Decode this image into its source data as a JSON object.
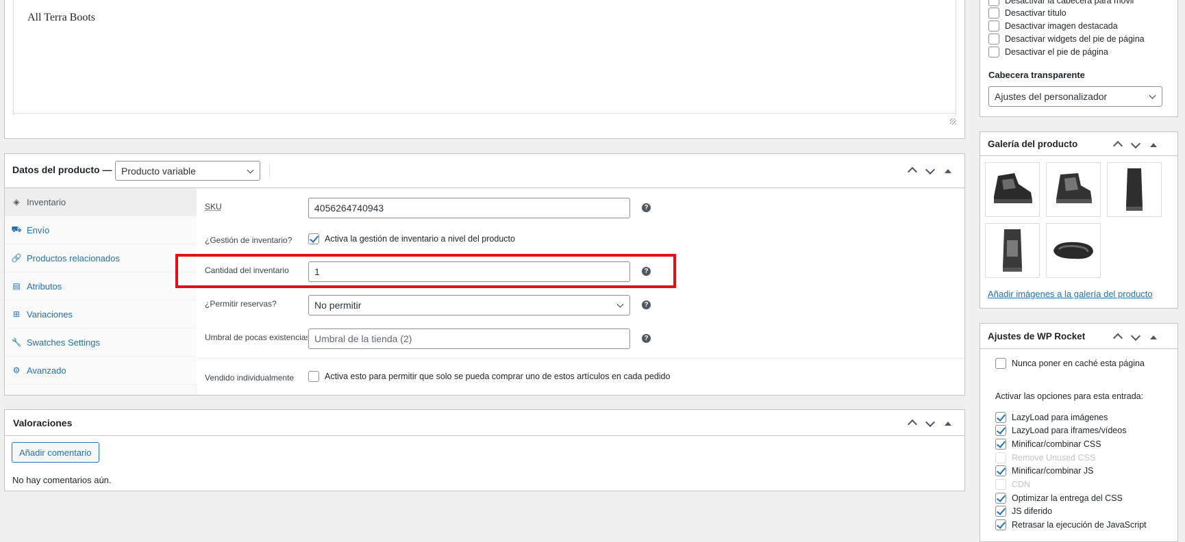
{
  "editor": {
    "content": "All Terra Boots"
  },
  "product_data": {
    "title": "Datos del producto —",
    "type_selected": "Producto variable",
    "tabs": [
      {
        "label": "Inventario",
        "icon": "tag-icon"
      },
      {
        "label": "Envío",
        "icon": "truck-icon"
      },
      {
        "label": "Productos relacionados",
        "icon": "link-icon"
      },
      {
        "label": "Atributos",
        "icon": "list-icon"
      },
      {
        "label": "Variaciones",
        "icon": "grid-icon"
      },
      {
        "label": "Swatches Settings",
        "icon": "wrench-icon"
      },
      {
        "label": "Avanzado",
        "icon": "gear-icon"
      }
    ],
    "fields": {
      "sku_label": "SKU",
      "sku_value": "4056264740943",
      "stock_mgmt_label": "¿Gestión de inventario?",
      "stock_mgmt_text": "Activa la gestión de inventario a nivel del producto",
      "stock_qty_label": "Cantidad del inventario",
      "stock_qty_value": "1",
      "backorders_label": "¿Permitir reservas?",
      "backorders_value": "No permitir",
      "low_stock_label": "Umbral de pocas existencias",
      "low_stock_placeholder": "Umbral de la tienda (2)",
      "sold_individually_label": "Vendido individualmente",
      "sold_individually_text": "Activa esto para permitir que solo se pueda comprar uno de estos artículos en cada pedido"
    },
    "highlight_color": "#e0101a"
  },
  "reviews": {
    "title": "Valoraciones",
    "add_button": "Añadir comentario",
    "empty_text": "No hay comentarios aún."
  },
  "sidebar": {
    "options": [
      {
        "label": "Desactivar la cabecera para móvil"
      },
      {
        "label": "Desactivar título"
      },
      {
        "label": "Desactivar imagen destacada"
      },
      {
        "label": "Desactivar widgets del pie de página"
      },
      {
        "label": "Desactivar el pie de página"
      }
    ],
    "transparent_header_label": "Cabecera transparente",
    "transparent_header_value": "Ajustes del personalizador",
    "gallery": {
      "title": "Galería del producto",
      "add_link": "Añadir imágenes a la galería del producto"
    },
    "rocket": {
      "title": "Ajustes de WP Rocket",
      "never_cache": "Nunca poner en caché esta página",
      "activate_label": "Activar las opciones para esta entrada:",
      "options": [
        {
          "label": "LazyLoad para imágenes",
          "checked": true,
          "disabled": false
        },
        {
          "label": "LazyLoad para iframes/vídeos",
          "checked": true,
          "disabled": false
        },
        {
          "label": "Minificar/combinar CSS",
          "checked": true,
          "disabled": false
        },
        {
          "label": "Remove Unused CSS",
          "checked": false,
          "disabled": true
        },
        {
          "label": "Minificar/combinar JS",
          "checked": true,
          "disabled": false
        },
        {
          "label": "CDN",
          "checked": false,
          "disabled": true
        },
        {
          "label": "Optimizar la entrega del CSS",
          "checked": true,
          "disabled": false
        },
        {
          "label": "JS diferido",
          "checked": true,
          "disabled": false
        },
        {
          "label": "Retrasar la ejecución de JavaScript",
          "checked": true,
          "disabled": false
        }
      ]
    }
  },
  "colors": {
    "link": "#2271b1",
    "border": "#c3c4c7",
    "bg": "#f0f0f1"
  }
}
